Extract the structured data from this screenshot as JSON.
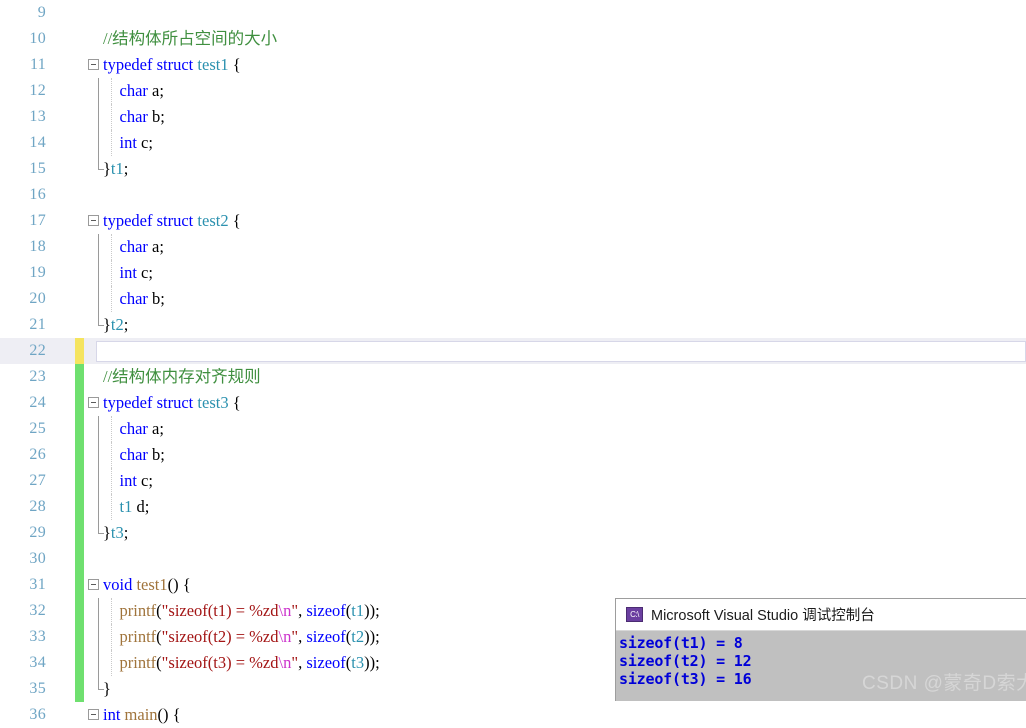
{
  "editor": {
    "name": "visual-studio-code-editor",
    "language": "C",
    "colors": {
      "keyword": "#0000ff",
      "type": "#2b91af",
      "function": "#a0743c",
      "comment": "#3f8f3f",
      "string": "#a31515",
      "escape": "#cc33cc",
      "line_number": "#6fa5c4",
      "change_bar_unsaved": "#f5e45f",
      "change_bar_saved": "#6fe06f",
      "background": "#ffffff"
    },
    "lines": [
      {
        "num": "9",
        "tokens": []
      },
      {
        "num": "10",
        "tokens": [
          {
            "t": "//结构体所占空间的大小",
            "c": "com"
          }
        ]
      },
      {
        "num": "11",
        "tokens": [
          {
            "t": "typedef",
            "c": "kw"
          },
          {
            "t": " "
          },
          {
            "t": "struct",
            "c": "kw"
          },
          {
            "t": " "
          },
          {
            "t": "test1",
            "c": "type"
          },
          {
            "t": " {"
          }
        ]
      },
      {
        "num": "12",
        "tokens": [
          {
            "t": "    "
          },
          {
            "t": "char",
            "c": "kw"
          },
          {
            "t": " a;"
          }
        ]
      },
      {
        "num": "13",
        "tokens": [
          {
            "t": "    "
          },
          {
            "t": "char",
            "c": "kw"
          },
          {
            "t": " b;"
          }
        ]
      },
      {
        "num": "14",
        "tokens": [
          {
            "t": "    "
          },
          {
            "t": "int",
            "c": "kw"
          },
          {
            "t": " c;"
          }
        ]
      },
      {
        "num": "15",
        "tokens": [
          {
            "t": "}"
          },
          {
            "t": "t1",
            "c": "type"
          },
          {
            "t": ";"
          }
        ]
      },
      {
        "num": "16",
        "tokens": []
      },
      {
        "num": "17",
        "tokens": [
          {
            "t": "typedef",
            "c": "kw"
          },
          {
            "t": " "
          },
          {
            "t": "struct",
            "c": "kw"
          },
          {
            "t": " "
          },
          {
            "t": "test2",
            "c": "type"
          },
          {
            "t": " {"
          }
        ]
      },
      {
        "num": "18",
        "tokens": [
          {
            "t": "    "
          },
          {
            "t": "char",
            "c": "kw"
          },
          {
            "t": " a;"
          }
        ]
      },
      {
        "num": "19",
        "tokens": [
          {
            "t": "    "
          },
          {
            "t": "int",
            "c": "kw"
          },
          {
            "t": " c;"
          }
        ]
      },
      {
        "num": "20",
        "tokens": [
          {
            "t": "    "
          },
          {
            "t": "char",
            "c": "kw"
          },
          {
            "t": " b;"
          }
        ]
      },
      {
        "num": "21",
        "tokens": [
          {
            "t": "}"
          },
          {
            "t": "t2",
            "c": "type"
          },
          {
            "t": ";"
          }
        ]
      },
      {
        "num": "22",
        "tokens": []
      },
      {
        "num": "23",
        "tokens": [
          {
            "t": "//结构体内存对齐规则",
            "c": "com"
          }
        ]
      },
      {
        "num": "24",
        "tokens": [
          {
            "t": "typedef",
            "c": "kw"
          },
          {
            "t": " "
          },
          {
            "t": "struct",
            "c": "kw"
          },
          {
            "t": " "
          },
          {
            "t": "test3",
            "c": "type"
          },
          {
            "t": " {"
          }
        ]
      },
      {
        "num": "25",
        "tokens": [
          {
            "t": "    "
          },
          {
            "t": "char",
            "c": "kw"
          },
          {
            "t": " a;"
          }
        ]
      },
      {
        "num": "26",
        "tokens": [
          {
            "t": "    "
          },
          {
            "t": "char",
            "c": "kw"
          },
          {
            "t": " b;"
          }
        ]
      },
      {
        "num": "27",
        "tokens": [
          {
            "t": "    "
          },
          {
            "t": "int",
            "c": "kw"
          },
          {
            "t": " c;"
          }
        ]
      },
      {
        "num": "28",
        "tokens": [
          {
            "t": "    "
          },
          {
            "t": "t1",
            "c": "type"
          },
          {
            "t": " d;"
          }
        ]
      },
      {
        "num": "29",
        "tokens": [
          {
            "t": "}"
          },
          {
            "t": "t3",
            "c": "type"
          },
          {
            "t": ";"
          }
        ]
      },
      {
        "num": "30",
        "tokens": []
      },
      {
        "num": "31",
        "tokens": [
          {
            "t": "void",
            "c": "kw"
          },
          {
            "t": " "
          },
          {
            "t": "test1",
            "c": "fn"
          },
          {
            "t": "() {"
          }
        ]
      },
      {
        "num": "32",
        "tokens": [
          {
            "t": "    "
          },
          {
            "t": "printf",
            "c": "fn"
          },
          {
            "t": "("
          },
          {
            "t": "\"sizeof(t1) = %zd",
            "c": "str"
          },
          {
            "t": "\\n",
            "c": "esc"
          },
          {
            "t": "\"",
            "c": "str"
          },
          {
            "t": ", "
          },
          {
            "t": "sizeof",
            "c": "kw"
          },
          {
            "t": "("
          },
          {
            "t": "t1",
            "c": "type"
          },
          {
            "t": "));"
          }
        ]
      },
      {
        "num": "33",
        "tokens": [
          {
            "t": "    "
          },
          {
            "t": "printf",
            "c": "fn"
          },
          {
            "t": "("
          },
          {
            "t": "\"sizeof(t2) = %zd",
            "c": "str"
          },
          {
            "t": "\\n",
            "c": "esc"
          },
          {
            "t": "\"",
            "c": "str"
          },
          {
            "t": ", "
          },
          {
            "t": "sizeof",
            "c": "kw"
          },
          {
            "t": "("
          },
          {
            "t": "t2",
            "c": "type"
          },
          {
            "t": "));"
          }
        ]
      },
      {
        "num": "34",
        "tokens": [
          {
            "t": "    "
          },
          {
            "t": "printf",
            "c": "fn"
          },
          {
            "t": "("
          },
          {
            "t": "\"sizeof(t3) = %zd",
            "c": "str"
          },
          {
            "t": "\\n",
            "c": "esc"
          },
          {
            "t": "\"",
            "c": "str"
          },
          {
            "t": ", "
          },
          {
            "t": "sizeof",
            "c": "kw"
          },
          {
            "t": "("
          },
          {
            "t": "t3",
            "c": "type"
          },
          {
            "t": "));"
          }
        ]
      },
      {
        "num": "35",
        "tokens": [
          {
            "t": "}"
          }
        ]
      },
      {
        "num": "36",
        "tokens": [
          {
            "t": "int",
            "c": "kw"
          },
          {
            "t": " "
          },
          {
            "t": "main",
            "c": "fn"
          },
          {
            "t": "() {"
          }
        ]
      }
    ],
    "fold_lines": [
      "11",
      "17",
      "24",
      "31",
      "36"
    ],
    "rail_lines": [
      "12",
      "13",
      "14",
      "15",
      "18",
      "19",
      "20",
      "21",
      "25",
      "26",
      "27",
      "28",
      "29",
      "32",
      "33",
      "34",
      "35"
    ],
    "rail_end_lines": [
      "15",
      "21",
      "29",
      "35"
    ],
    "indent_guide_lines": [
      "12",
      "13",
      "14",
      "18",
      "19",
      "20",
      "25",
      "26",
      "27",
      "28",
      "32",
      "33",
      "34"
    ],
    "change_bars": {
      "unsaved": [
        "22"
      ],
      "saved": [
        "23",
        "24",
        "25",
        "26",
        "27",
        "28",
        "29",
        "30",
        "31",
        "32",
        "33",
        "34",
        "35"
      ]
    },
    "current_line": "22"
  },
  "console": {
    "name": "debug-console-window",
    "icon": "command-prompt-icon",
    "icon_label": "C:\\",
    "title": "Microsoft Visual Studio 调试控制台",
    "output": [
      "sizeof(t1) = 8",
      "sizeof(t2) = 12",
      "sizeof(t3) = 16"
    ]
  },
  "watermark": {
    "text": "CSDN @蒙奇D索大"
  }
}
